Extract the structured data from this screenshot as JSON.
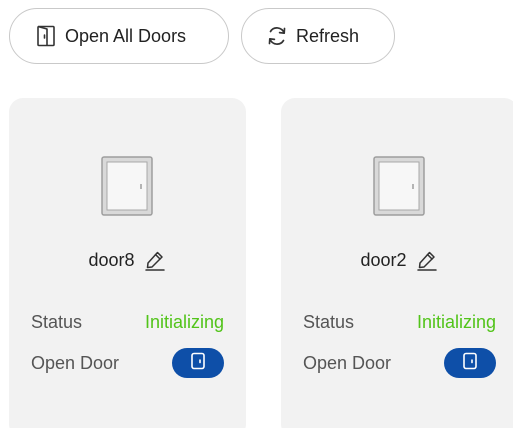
{
  "toolbar": {
    "open_all_label": "Open All Doors",
    "open_all_icon": "door-icon",
    "refresh_label": "Refresh",
    "refresh_icon": "refresh-icon"
  },
  "doors": [
    {
      "name": "door8",
      "status_label": "Status",
      "status_value": "Initializing",
      "open_label": "Open Door"
    },
    {
      "name": "door2",
      "status_label": "Status",
      "status_value": "Initializing",
      "open_label": "Open Door"
    }
  ],
  "colors": {
    "status_initializing": "#52c41a",
    "toggle_active": "#0e4fa8",
    "card_background": "#f2f2f2"
  }
}
